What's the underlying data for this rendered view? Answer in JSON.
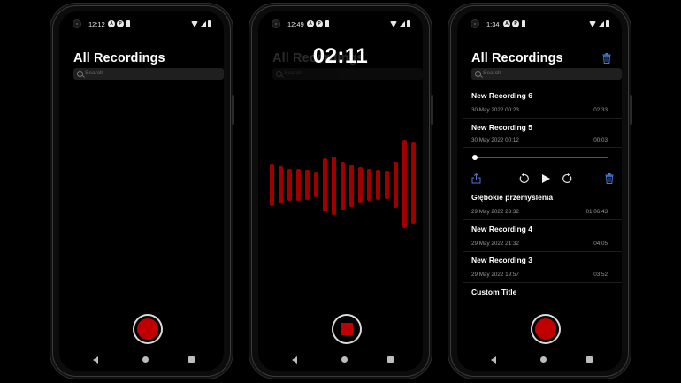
{
  "phones": {
    "p1": {
      "status": {
        "time": "12:12"
      },
      "title": "All Recordings",
      "search": {
        "placeholder": "Search"
      }
    },
    "p2": {
      "status": {
        "time": "12:49"
      },
      "title": "All Recordings",
      "search": {
        "placeholder": "Search"
      },
      "timer": "02:11"
    },
    "p3": {
      "status": {
        "time": "1:34"
      },
      "title": "All Recordings",
      "search": {
        "placeholder": "Search"
      },
      "recordings": [
        {
          "title": "New Recording 6",
          "date": "30 May 2022 00:23",
          "duration": "02:33"
        },
        {
          "title": "New Recording 5",
          "date": "30 May 2022 00:12",
          "duration": "00:03"
        },
        {
          "title": "Głębokie przemyślenia",
          "date": "29 May 2022 23:32",
          "duration": "01:06:43"
        },
        {
          "title": "New Recording 4",
          "date": "29 May 2022 21:32",
          "duration": "04:05"
        },
        {
          "title": "New Recording 3",
          "date": "29 May 2022 19:57",
          "duration": "03:52"
        },
        {
          "title": "Custom Title",
          "date": "",
          "duration": ""
        }
      ],
      "player": {
        "progress": 0.0
      }
    }
  },
  "colors": {
    "record_red": "#c00000",
    "wave_red": "#9e0000",
    "accent_blue": "#4a7ad9",
    "background": "#000000"
  },
  "icons": [
    "camera-icon",
    "notification-icon",
    "wifi-icon",
    "signal-icon",
    "battery-icon",
    "search-icon",
    "trash-icon",
    "share-icon",
    "rewind-icon",
    "play-icon",
    "forward-icon",
    "nav-back-icon",
    "nav-home-icon",
    "nav-recents-icon"
  ]
}
